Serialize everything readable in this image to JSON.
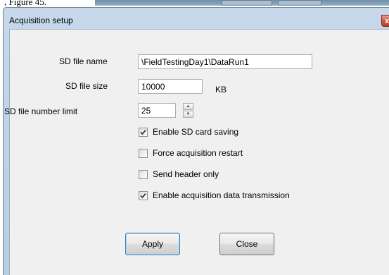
{
  "caption": ", Figure 45.",
  "dialog": {
    "title": "Acquisition setup",
    "close_glyph": "x"
  },
  "fields": {
    "file_name": {
      "label": "SD file name",
      "value": "\\FieldTestingDay1\\DataRun1"
    },
    "file_size": {
      "label": "SD file size",
      "value": "10000",
      "unit": "KB"
    },
    "file_limit": {
      "label": "SD file number limit",
      "value": "25"
    }
  },
  "options": [
    {
      "label": "Enable SD card saving",
      "checked": true
    },
    {
      "label": "Force acquisition restart",
      "checked": false
    },
    {
      "label": "Send header only",
      "checked": false
    },
    {
      "label": "Enable acquisition data transmission",
      "checked": true
    }
  ],
  "buttons": {
    "apply": "Apply",
    "close": "Close"
  },
  "colors": {
    "titlebar": "#c6d8ea",
    "client": "#f0f0f0",
    "close_button": "#c8543c",
    "check_mark": "#1f3e6a"
  },
  "icons": {
    "close": "close-icon",
    "check": "check-mark-icon",
    "spin_up": "spin-up-arrow-icon",
    "spin_down": "spin-down-arrow-icon"
  }
}
